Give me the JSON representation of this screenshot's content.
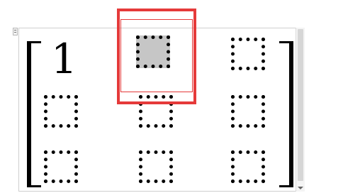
{
  "editor": {
    "matrix": {
      "rows": [
        [
          "1",
          "",
          ""
        ],
        [
          "",
          "",
          ""
        ],
        [
          "",
          "",
          ""
        ]
      ]
    }
  },
  "colors": {
    "highlight": "#e53a3a",
    "selected_slot": "#c6c6c6"
  }
}
